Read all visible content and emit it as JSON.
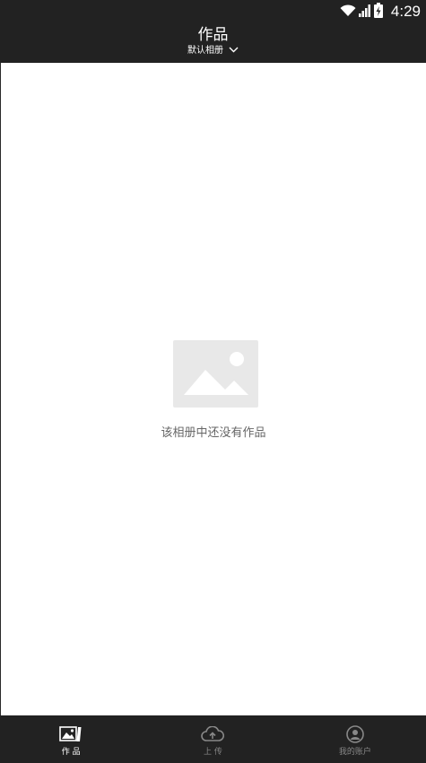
{
  "status_bar": {
    "time": "4:29",
    "icons": [
      "wifi-icon",
      "signal-icon",
      "battery-charging-icon"
    ]
  },
  "header": {
    "title": "作品",
    "album_label": "默认相册",
    "album_dropdown_icon": "chevron-down-icon"
  },
  "main": {
    "empty_icon": "image-placeholder-icon",
    "empty_message": "该相册中还没有作品"
  },
  "bottom_nav": {
    "items": [
      {
        "label": "作 品",
        "icon": "gallery-icon",
        "active": true
      },
      {
        "label": "上 传",
        "icon": "cloud-upload-icon",
        "active": false
      },
      {
        "label": "我的账户",
        "icon": "account-icon",
        "active": false
      }
    ]
  },
  "colors": {
    "bar_background": "#222222",
    "inactive_nav": "#888888",
    "active_nav": "#ffffff",
    "placeholder_gray": "#e8e8e8",
    "empty_text": "#666666"
  }
}
